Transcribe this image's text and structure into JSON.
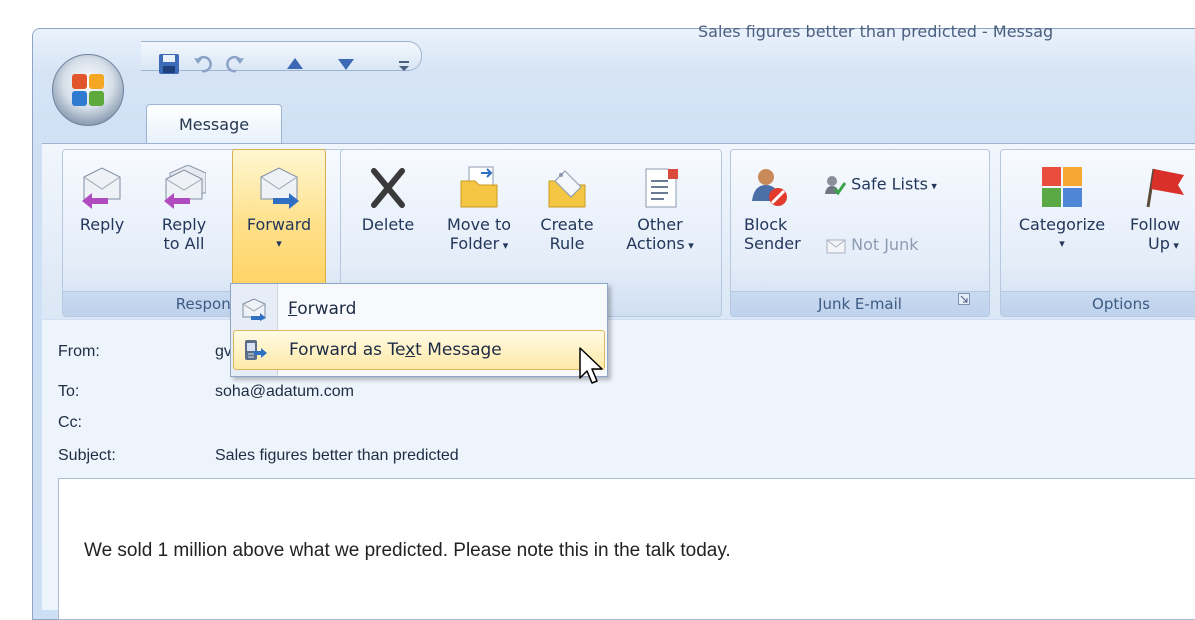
{
  "window": {
    "title": "Sales figures better than predicted - Messag"
  },
  "quick_access": {
    "icons": [
      "save-icon",
      "undo-icon",
      "redo-icon",
      "previous-item-icon",
      "next-item-icon",
      "customize-toolbar-icon"
    ]
  },
  "tab": {
    "label": "Message"
  },
  "ribbon": {
    "respond": {
      "label": "Respond",
      "reply": "Reply",
      "reply_all_1": "Reply",
      "reply_all_2": "to All",
      "forward": "Forward"
    },
    "actions": {
      "delete": "Delete",
      "move_1": "Move to",
      "move_2": "Folder",
      "create_1": "Create",
      "create_2": "Rule",
      "other_1": "Other",
      "other_2": "Actions"
    },
    "junk": {
      "label": "Junk E-mail",
      "block_1": "Block",
      "block_2": "Sender",
      "safe_lists": "Safe Lists",
      "not_junk": "Not Junk"
    },
    "options": {
      "label": "Options",
      "categorize": "Categorize",
      "follow_1": "Follow",
      "follow_2": "Up"
    }
  },
  "forward_menu": {
    "items": [
      {
        "pre": "",
        "key": "F",
        "post": "orward"
      },
      {
        "pre": "Forward as Te",
        "key": "x",
        "post": "t Message"
      }
    ]
  },
  "header": {
    "from_label": "From:",
    "from_value": "gv",
    "to_label": "To:",
    "to_value": "soha@adatum.com",
    "cc_label": "Cc:",
    "subject_label": "Subject:",
    "subject_value": "Sales figures better than predicted"
  },
  "body": {
    "text": "We sold 1 million above what we predicted. Please note this in the talk today."
  }
}
